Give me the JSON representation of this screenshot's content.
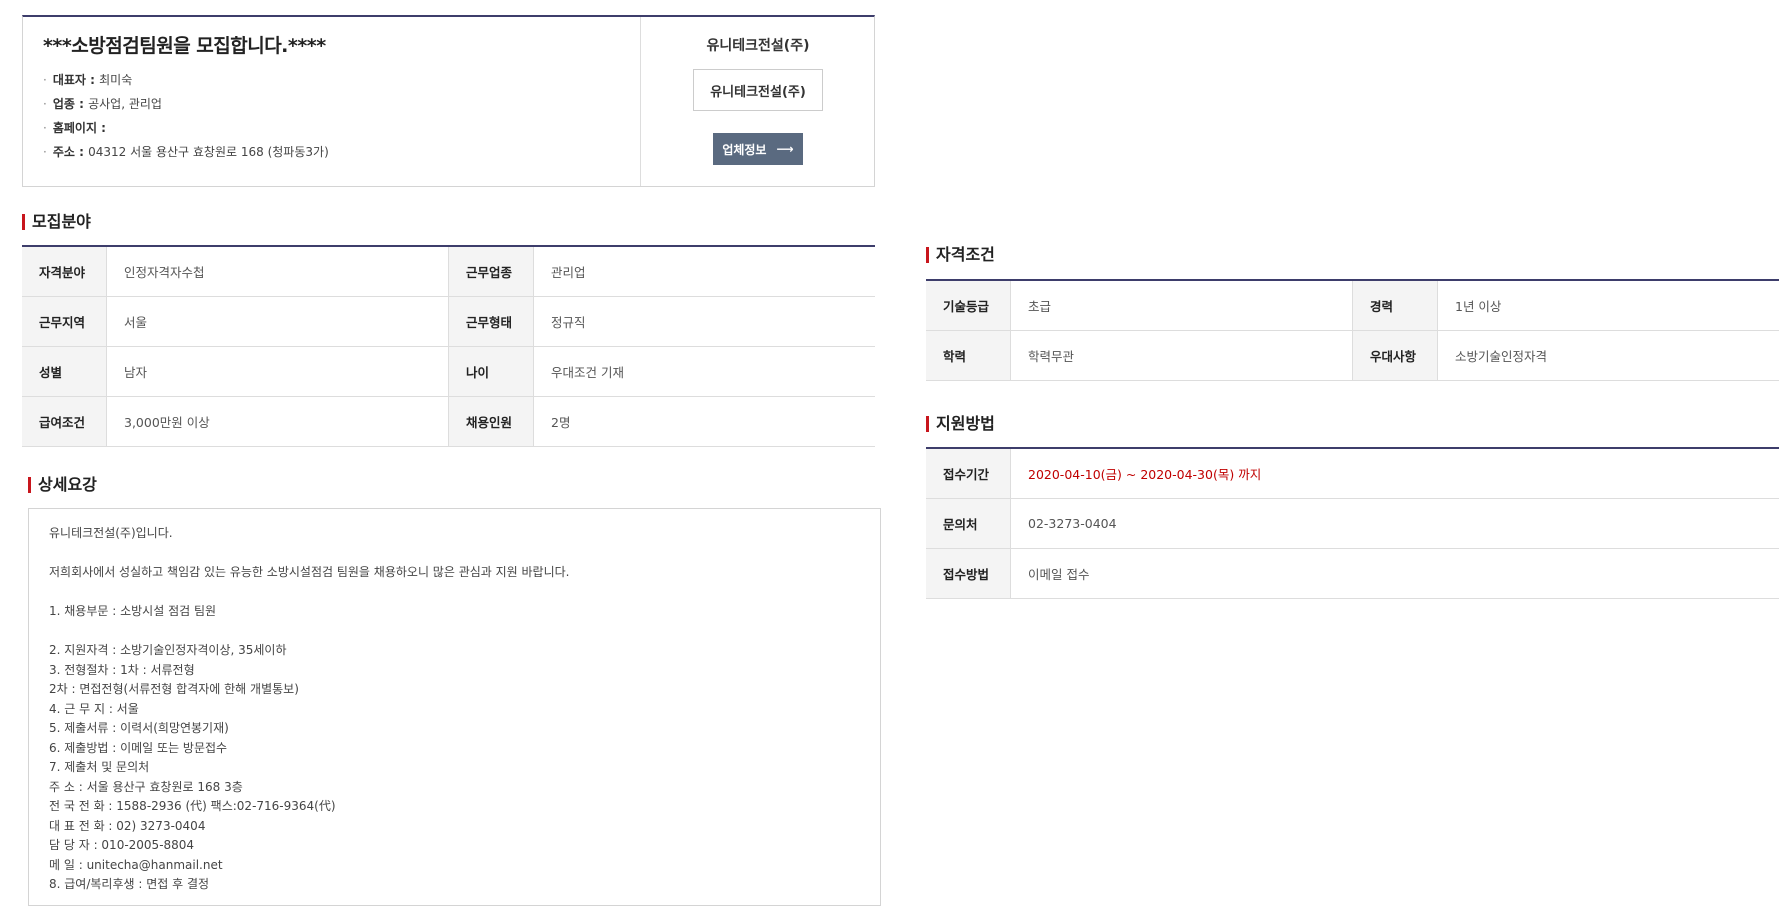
{
  "company": {
    "title": "***소방점검팀원을 모집합니다.****",
    "info": [
      {
        "label": "대표자",
        "value": "최미숙"
      },
      {
        "label": "업종",
        "value": "공사업, 관리업"
      },
      {
        "label": "홈페이지",
        "value": ""
      },
      {
        "label": "주소",
        "value": "04312 서울 용산구 효창원로 168 (청파동3가)"
      }
    ],
    "name": "유니테크전설(주)",
    "logo_text": "유니테크전설(주)",
    "info_button": "업체정보",
    "info_button_arrow": "⟶"
  },
  "recruit": {
    "title": "모집분야",
    "rows": [
      {
        "h1": "자격분야",
        "v1": "인정자격자수첩",
        "h2": "근무업종",
        "v2": "관리업"
      },
      {
        "h1": "근무지역",
        "v1": "서울",
        "h2": "근무형태",
        "v2": "정규직"
      },
      {
        "h1": "성별",
        "v1": "남자",
        "h2": "나이",
        "v2": "우대조건 기재"
      },
      {
        "h1": "급여조건",
        "v1": "3,000만원 이상",
        "h2": "채용인원",
        "v2": "2명"
      }
    ]
  },
  "qualification": {
    "title": "자격조건",
    "rows": [
      {
        "h1": "기술등급",
        "v1": "초급",
        "h2": "경력",
        "v2": "1년 이상"
      },
      {
        "h1": "학력",
        "v1": "학력무관",
        "h2": "우대사항",
        "v2": "소방기술인정자격"
      }
    ]
  },
  "apply": {
    "title": "지원방법",
    "rows": [
      {
        "h": "접수기간",
        "v": "2020-04-10(금) ~ 2020-04-30(목) 까지"
      },
      {
        "h": "문의처",
        "v": "02-3273-0404"
      },
      {
        "h": "접수방법",
        "v": "이메일 접수"
      }
    ]
  },
  "detail": {
    "title": "상세요강",
    "lines": [
      "유니테크전설(주)입니다.",
      "",
      "저희회사에서 성실하고 책임감 있는 유능한 소방시설점검 팀원을 채용하오니 많은 관심과 지원 바랍니다.",
      "",
      "1. 채용부문 : 소방시설 점검 팀원",
      "",
      "2. 지원자격 : 소방기술인정자격이상, 35세이하",
      "3. 전형절차 : 1차 : 서류전형",
      "2차 : 면접전형(서류전형 합격자에 한해 개별통보)",
      "4. 근 무 지 : 서울",
      "5. 제출서류 : 이력서(희망연봉기재)",
      "6. 제출방법 : 이메일 또는 방문접수",
      "7. 제출처 및 문의처",
      "주 소 : 서울 용산구 효창원로 168 3층",
      "전 국 전 화 : 1588-2936 (代) 팩스:02-716-9364(代)",
      "대 표 전 화 : 02) 3273-0404",
      "담 당 자 : 010-2005-8804",
      "메 일 : unitecha@hanmail.net",
      "8. 급여/복리후생 : 면접 후 결정"
    ]
  }
}
